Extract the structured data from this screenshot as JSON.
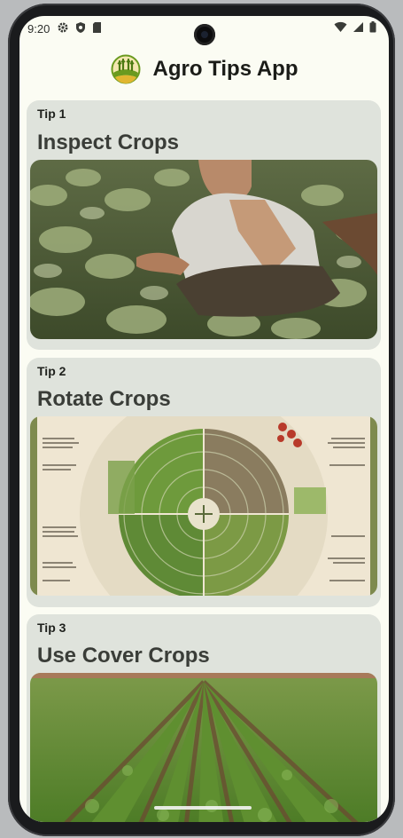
{
  "status_bar": {
    "time": "9:20",
    "left_icons": [
      "gear-icon",
      "shield-icon",
      "sd-card-icon"
    ],
    "right_icons": [
      "wifi-icon",
      "cell-signal-icon",
      "battery-icon"
    ]
  },
  "app": {
    "title": "Agro Tips App",
    "logo_icon": "farm-field-logo-icon"
  },
  "tips": [
    {
      "label": "Tip 1",
      "title": "Inspect Crops",
      "image": "farmer-inspecting-crops-photo"
    },
    {
      "label": "Tip 2",
      "title": "Rotate Crops",
      "image": "crop-rotation-infographic"
    },
    {
      "label": "Tip 3",
      "title": "Use Cover Crops",
      "image": "cover-crop-field-photo"
    }
  ],
  "colors": {
    "background": "#fbfcf3",
    "card": "#dfe3dc",
    "title_text": "#1b1c18",
    "tip_title_text": "#3a3d38",
    "logo_green": "#6a9a1f",
    "logo_yellow": "#e0b630"
  }
}
